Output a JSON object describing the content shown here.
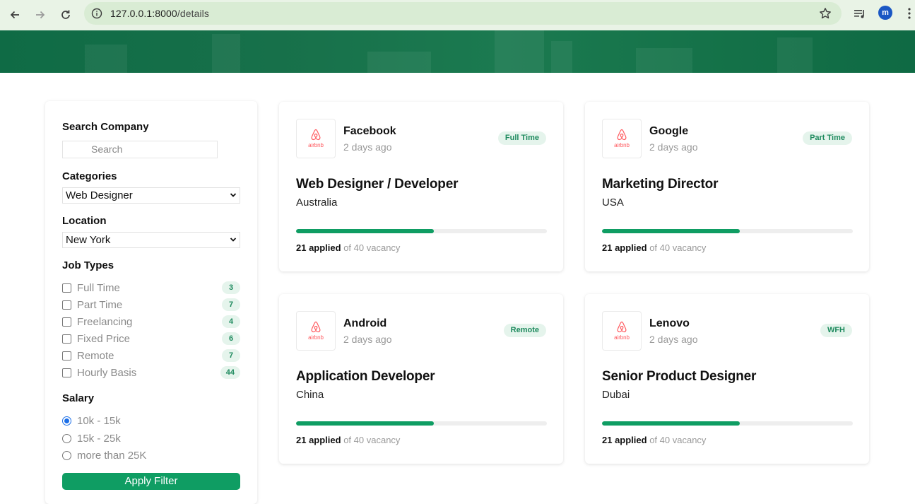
{
  "browser": {
    "url_host": "127.0.0.1:8000",
    "url_path": "/details",
    "profile_initial": "m"
  },
  "sidebar": {
    "search_heading": "Search Company",
    "search_placeholder": "Search",
    "categories_heading": "Categories",
    "category_selected": "Web Designer",
    "location_heading": "Location",
    "location_selected": "New York",
    "job_types_heading": "Job Types",
    "job_types": [
      {
        "label": "Full Time",
        "count": "3"
      },
      {
        "label": "Part Time",
        "count": "7"
      },
      {
        "label": "Freelancing",
        "count": "4"
      },
      {
        "label": "Fixed Price",
        "count": "6"
      },
      {
        "label": "Remote",
        "count": "7"
      },
      {
        "label": "Hourly Basis",
        "count": "44"
      }
    ],
    "salary_heading": "Salary",
    "salary_options": [
      {
        "label": "10k - 15k",
        "selected": true
      },
      {
        "label": "15k - 25k",
        "selected": false
      },
      {
        "label": "more than 25K",
        "selected": false
      }
    ],
    "apply_label": "Apply Filter"
  },
  "jobs": [
    {
      "logo_text": "airbnb",
      "company": "Facebook",
      "posted": "2 days ago",
      "type": "Full Time",
      "title": "Web Designer / Developer",
      "location": "Australia",
      "applied": "21 applied",
      "vacancy": "of 40 vacancy",
      "fill_fraction": 0.55
    },
    {
      "logo_text": "airbnb",
      "company": "Google",
      "posted": "2 days ago",
      "type": "Part Time",
      "title": "Marketing Director",
      "location": "USA",
      "applied": "21 applied",
      "vacancy": "of 40 vacancy",
      "fill_fraction": 0.55
    },
    {
      "logo_text": "airbnb",
      "company": "Android",
      "posted": "2 days ago",
      "type": "Remote",
      "title": "Application Developer",
      "location": "China",
      "applied": "21 applied",
      "vacancy": "of 40 vacancy",
      "fill_fraction": 0.55
    },
    {
      "logo_text": "airbnb",
      "company": "Lenovo",
      "posted": "2 days ago",
      "type": "WFH",
      "title": "Senior Product Designer",
      "location": "Dubai",
      "applied": "21 applied",
      "vacancy": "of 40 vacancy",
      "fill_fraction": 0.55
    }
  ],
  "colors": {
    "accent": "#0f9d63",
    "hero": "#17704a",
    "badge_bg": "#e5f4ec",
    "badge_text": "#1e8a5e",
    "logo": "#ff5a5f"
  },
  "icons": {
    "back": "arrow-left-icon",
    "forward": "arrow-right-icon",
    "reload": "reload-icon",
    "info": "info-icon",
    "bookmark": "star-icon",
    "media": "media-control-icon",
    "menu": "kebab-menu-icon",
    "company_logo": "airbnb-logo-icon"
  }
}
